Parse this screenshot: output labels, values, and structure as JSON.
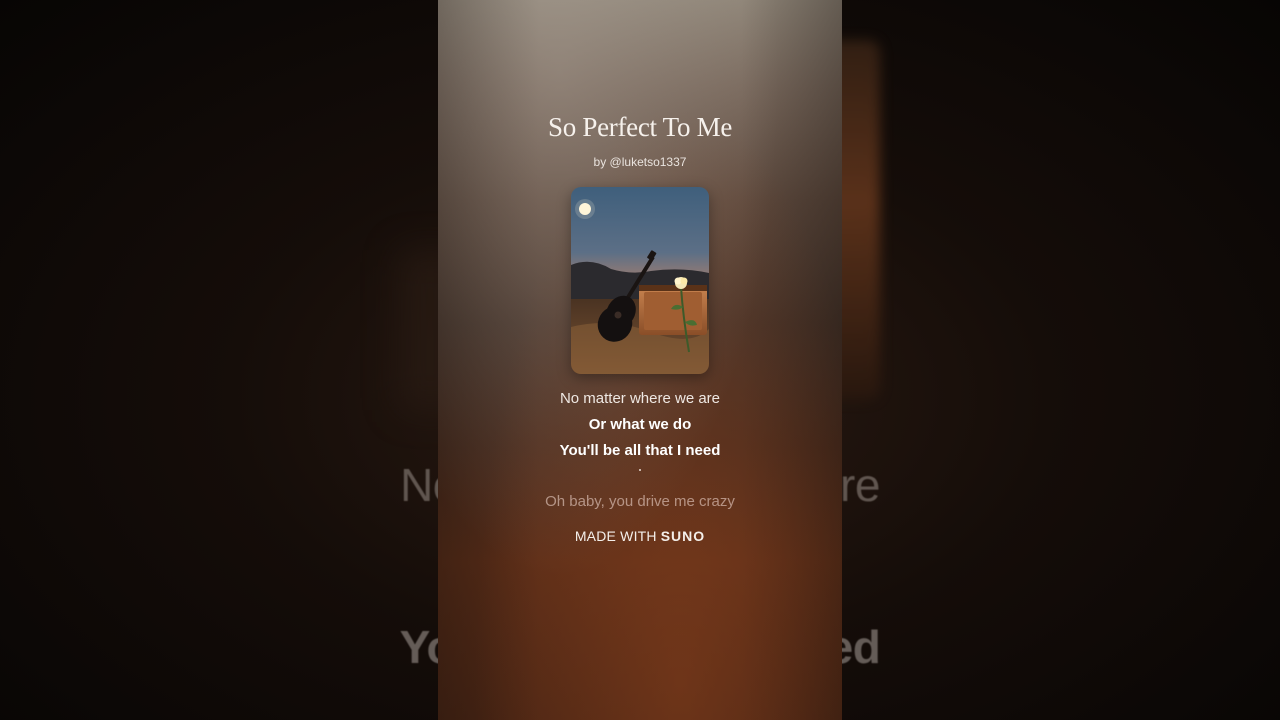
{
  "song": {
    "title": "So Perfect To Me",
    "artist_line": "by @luketso1337"
  },
  "cover_art": {
    "icon": "album-cover-image",
    "description_icons": [
      "moon-icon",
      "guitar-icon",
      "amplifier-icon",
      "flower-icon"
    ]
  },
  "lyrics": {
    "previous": "No matter where we are",
    "current_1": "Or what we do",
    "current_2": "You'll be all that I need",
    "next": "Oh baby, you drive me crazy"
  },
  "background_lyrics": {
    "line_1": "No matter where we are",
    "line_2": "You'll be all that I need"
  },
  "footer": {
    "made_with": "MADE WITH",
    "brand": "SUNO"
  },
  "colors": {
    "text_primary": "#ffffff",
    "text_dim": "#e6cdc3",
    "accent_warm": "#5a2d18"
  }
}
